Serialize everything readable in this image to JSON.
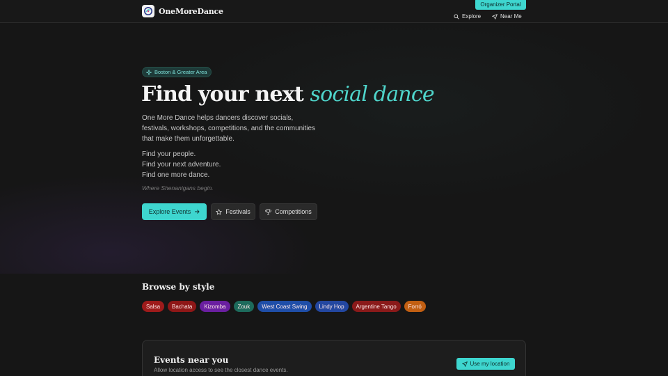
{
  "header": {
    "brand": "OneMoreDance",
    "portal_label": "Organizer Portal",
    "nav": {
      "explore": "Explore",
      "near_me": "Near Me"
    }
  },
  "hero": {
    "location": "Boston & Greater Area",
    "title_plain": "Find your next ",
    "title_accent": "social dance",
    "description": "One More Dance helps dancers discover socials, festivals, workshops, competitions, and the communities that make them unforgettable.",
    "taglines": [
      "Find your people.",
      "Find your next adventure.",
      "Find one more dance."
    ],
    "motto": "Where Shenanigans begin.",
    "buttons": {
      "explore": "Explore Events",
      "festivals": "Festivals",
      "competitions": "Competitions"
    }
  },
  "browse": {
    "title": "Browse by style",
    "styles": [
      {
        "label": "Salsa",
        "color": "#9e1b1b"
      },
      {
        "label": "Bachata",
        "color": "#8e1717"
      },
      {
        "label": "Kizomba",
        "color": "#6a1fa0"
      },
      {
        "label": "Zouk",
        "color": "#1d6b5c"
      },
      {
        "label": "West Coast Swing",
        "color": "#1f4ea8"
      },
      {
        "label": "Lindy Hop",
        "color": "#2347a0"
      },
      {
        "label": "Argentine Tango",
        "color": "#8a1a1a"
      },
      {
        "label": "Forró",
        "color": "#c25f12"
      }
    ]
  },
  "events": {
    "title": "Events near you",
    "subtitle": "Allow location access to see the closest dance events.",
    "button": "Use my location"
  },
  "colors": {
    "accent": "#3ed6cf",
    "background": "#161616"
  }
}
